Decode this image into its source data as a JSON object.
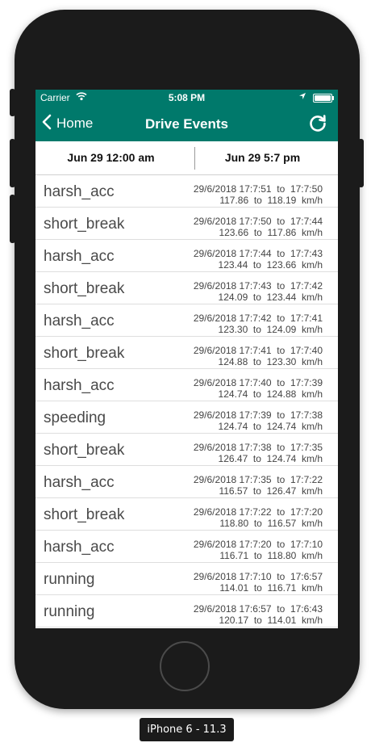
{
  "status_bar": {
    "carrier": "Carrier",
    "time": "5:08 PM",
    "wifi_icon": "wifi-icon",
    "location_icon": "location-arrow-icon",
    "battery_icon": "battery-icon"
  },
  "nav": {
    "back_label": "Home",
    "title": "Drive Events",
    "back_icon": "chevron-left-icon",
    "refresh_icon": "refresh-icon",
    "color": "#00796b"
  },
  "date_range": {
    "start": "Jun 29  12:00 am",
    "end": "Jun 29 5:7 pm"
  },
  "events": [
    {
      "type": "harsh_acc",
      "time_from": "29/6/2018 17:7:51",
      "time_to": "17:7:50",
      "speed_from": "117.86",
      "speed_to": "118.19",
      "unit": "km/h"
    },
    {
      "type": "short_break",
      "time_from": "29/6/2018 17:7:50",
      "time_to": "17:7:44",
      "speed_from": "123.66",
      "speed_to": "117.86",
      "unit": "km/h"
    },
    {
      "type": "harsh_acc",
      "time_from": "29/6/2018 17:7:44",
      "time_to": "17:7:43",
      "speed_from": "123.44",
      "speed_to": "123.66",
      "unit": "km/h"
    },
    {
      "type": "short_break",
      "time_from": "29/6/2018 17:7:43",
      "time_to": "17:7:42",
      "speed_from": "124.09",
      "speed_to": "123.44",
      "unit": "km/h"
    },
    {
      "type": "harsh_acc",
      "time_from": "29/6/2018 17:7:42",
      "time_to": "17:7:41",
      "speed_from": "123.30",
      "speed_to": "124.09",
      "unit": "km/h"
    },
    {
      "type": "short_break",
      "time_from": "29/6/2018 17:7:41",
      "time_to": "17:7:40",
      "speed_from": "124.88",
      "speed_to": "123.30",
      "unit": "km/h"
    },
    {
      "type": "harsh_acc",
      "time_from": "29/6/2018 17:7:40",
      "time_to": "17:7:39",
      "speed_from": "124.74",
      "speed_to": "124.88",
      "unit": "km/h"
    },
    {
      "type": "speeding",
      "time_from": "29/6/2018 17:7:39",
      "time_to": "17:7:38",
      "speed_from": "124.74",
      "speed_to": "124.74",
      "unit": "km/h"
    },
    {
      "type": "short_break",
      "time_from": "29/6/2018 17:7:38",
      "time_to": "17:7:35",
      "speed_from": "126.47",
      "speed_to": "124.74",
      "unit": "km/h"
    },
    {
      "type": "harsh_acc",
      "time_from": "29/6/2018 17:7:35",
      "time_to": "17:7:22",
      "speed_from": "116.57",
      "speed_to": "126.47",
      "unit": "km/h"
    },
    {
      "type": "short_break",
      "time_from": "29/6/2018 17:7:22",
      "time_to": "17:7:20",
      "speed_from": "118.80",
      "speed_to": "116.57",
      "unit": "km/h"
    },
    {
      "type": "harsh_acc",
      "time_from": "29/6/2018 17:7:20",
      "time_to": "17:7:10",
      "speed_from": "116.71",
      "speed_to": "118.80",
      "unit": "km/h"
    },
    {
      "type": "running",
      "time_from": "29/6/2018 17:7:10",
      "time_to": "17:6:57",
      "speed_from": "114.01",
      "speed_to": "116.71",
      "unit": "km/h"
    },
    {
      "type": "running",
      "time_from": "29/6/2018 17:6:57",
      "time_to": "17:6:43",
      "speed_from": "120.17",
      "speed_to": "114.01",
      "unit": "km/h"
    }
  ],
  "connector": "to",
  "device_label": "iPhone 6 - 11.3"
}
